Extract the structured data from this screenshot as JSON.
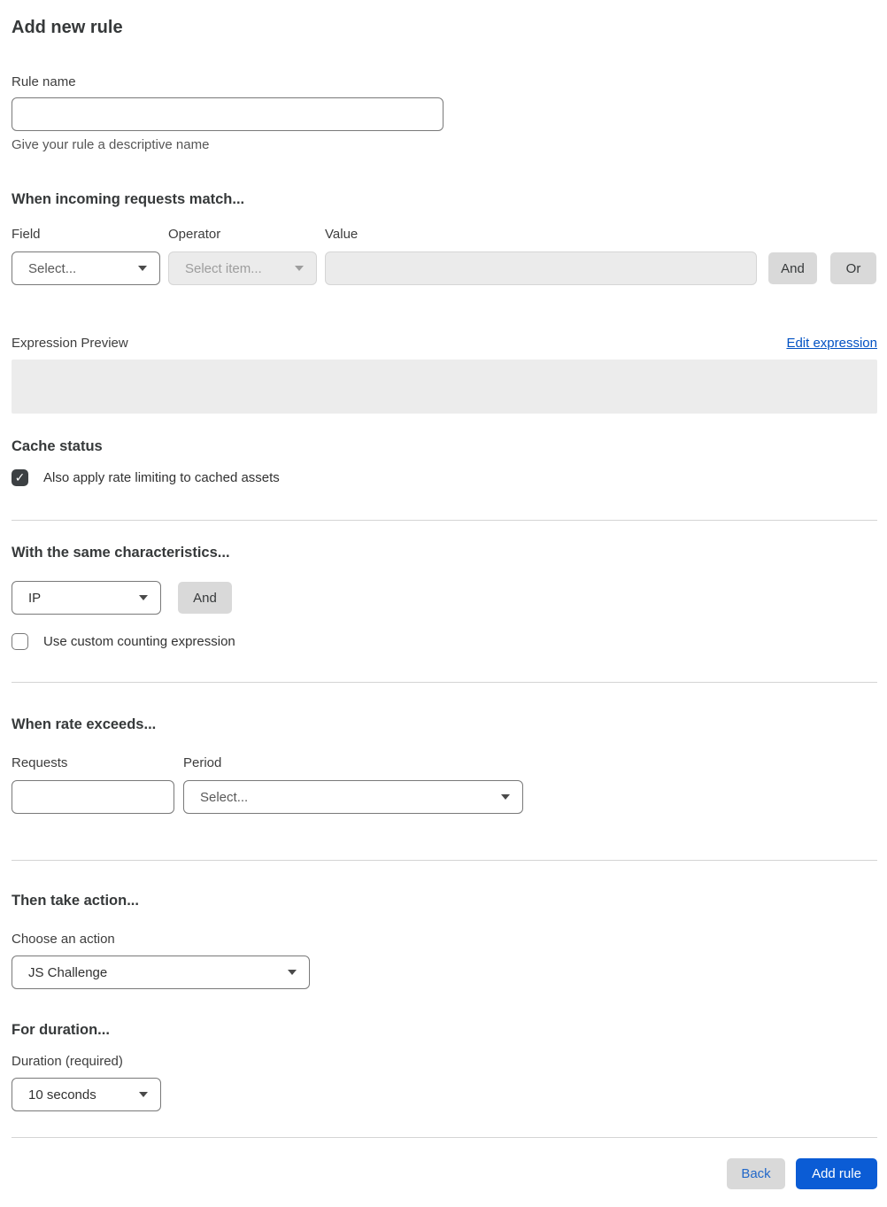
{
  "page": {
    "title": "Add new rule"
  },
  "rule_name": {
    "label": "Rule name",
    "value": "",
    "helper": "Give your rule a descriptive name"
  },
  "match": {
    "heading": "When incoming requests match...",
    "field": {
      "label": "Field",
      "selected": "Select...",
      "placeholder": true
    },
    "operator": {
      "label": "Operator",
      "selected": "Select item...",
      "placeholder": true,
      "disabled": true
    },
    "value": {
      "label": "Value",
      "value": "",
      "disabled": true
    },
    "and_button": "And",
    "or_button": "Or"
  },
  "expression": {
    "label": "Expression Preview",
    "edit_link": "Edit expression",
    "preview": ""
  },
  "cache": {
    "heading": "Cache status",
    "checkbox_label": "Also apply rate limiting to cached assets",
    "checked": true
  },
  "characteristics": {
    "heading": "With the same characteristics...",
    "select": {
      "selected": "IP",
      "placeholder": false
    },
    "and_button": "And",
    "checkbox_label": "Use custom counting expression",
    "checked": false
  },
  "rate": {
    "heading": "When rate exceeds...",
    "requests": {
      "label": "Requests",
      "value": ""
    },
    "period": {
      "label": "Period",
      "selected": "Select...",
      "placeholder": true
    }
  },
  "action": {
    "heading": "Then take action...",
    "label": "Choose an action",
    "selected": "JS Challenge"
  },
  "duration": {
    "heading": "For duration...",
    "label": "Duration (required)",
    "selected": "10 seconds"
  },
  "footer": {
    "back_button": "Back",
    "submit_button": "Add rule"
  },
  "icons": {
    "chevron": "chevron-down-icon",
    "check": "check-icon",
    "check_glyph": "✓"
  },
  "colors": {
    "primary_button": "#0b5cd5",
    "link": "#0051c3",
    "secondary_button": "#d9d9d9",
    "disabled_fill": "#ebebeb",
    "checkbox_checked": "#3c4043",
    "divider": "#d4d4d4",
    "heading_text": "#36393a"
  }
}
